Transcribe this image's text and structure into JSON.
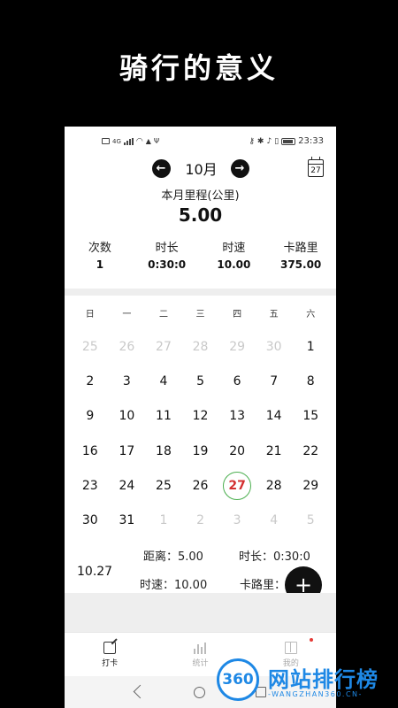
{
  "promo": {
    "title": "骑行的意义"
  },
  "statusbar": {
    "time": "23:33",
    "network": "4G"
  },
  "header": {
    "month": "10月",
    "prev_icon": "arrow-left-icon",
    "next_icon": "arrow-right-icon",
    "today_button_day": "27"
  },
  "summary": {
    "label": "本月里程(公里)",
    "value": "5.00"
  },
  "stats": [
    {
      "label": "次数",
      "value": "1"
    },
    {
      "label": "时长",
      "value": "0:30:0"
    },
    {
      "label": "时速",
      "value": "10.00"
    },
    {
      "label": "卡路里",
      "value": "375.00"
    }
  ],
  "calendar": {
    "weekdays": [
      "日",
      "一",
      "二",
      "三",
      "四",
      "五",
      "六"
    ],
    "weeks": [
      [
        "25",
        "26",
        "27",
        "28",
        "29",
        "30",
        "1"
      ],
      [
        "2",
        "3",
        "4",
        "5",
        "6",
        "7",
        "8"
      ],
      [
        "9",
        "10",
        "11",
        "12",
        "13",
        "14",
        "15"
      ],
      [
        "16",
        "17",
        "18",
        "19",
        "20",
        "21",
        "22"
      ],
      [
        "23",
        "24",
        "25",
        "26",
        "27",
        "28",
        "29"
      ],
      [
        "30",
        "31",
        "1",
        "2",
        "3",
        "4",
        "5"
      ]
    ],
    "muted": [
      [
        true,
        true,
        true,
        true,
        true,
        true,
        false
      ],
      [
        false,
        false,
        false,
        false,
        false,
        false,
        false
      ],
      [
        false,
        false,
        false,
        false,
        false,
        false,
        false
      ],
      [
        false,
        false,
        false,
        false,
        false,
        false,
        false
      ],
      [
        false,
        false,
        false,
        false,
        false,
        false,
        false
      ],
      [
        false,
        false,
        true,
        true,
        true,
        true,
        true
      ]
    ],
    "today": "27",
    "today_color": "#d32f2f",
    "today_ring_color": "#4caf50"
  },
  "detail": {
    "date": "10.27",
    "distance": "距离：5.00",
    "duration": "时长：0:30:0",
    "speed": "时速：10.00",
    "calories": "卡路里："
  },
  "fab_label": "+",
  "tabs": [
    {
      "label": "打卡",
      "icon": "checkin-edit-icon",
      "active": true
    },
    {
      "label": "统计",
      "icon": "bar-chart-icon",
      "active": false
    },
    {
      "label": "我的",
      "icon": "book-icon",
      "active": false
    }
  ],
  "watermark": {
    "logo": "360",
    "name": "网站排行榜",
    "url": "-WANGZHAN360.CN-",
    "color": "#1e88e5"
  }
}
